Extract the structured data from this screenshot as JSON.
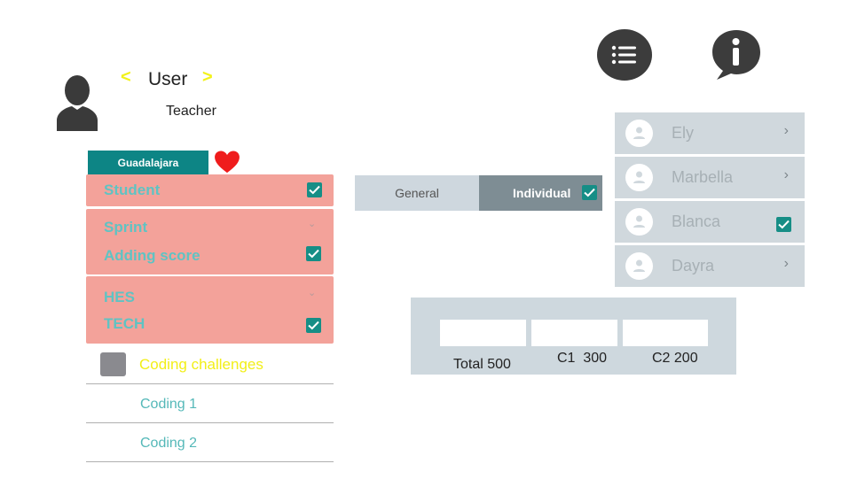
{
  "header": {
    "user_title": "User",
    "prev_arrow": "<",
    "next_arrow": ">",
    "role": "Teacher"
  },
  "location": {
    "label": "Guadalajara"
  },
  "filters": {
    "items": [
      {
        "label": "Student",
        "control": "checkbox",
        "checked": true
      },
      {
        "label": "Sprint",
        "control": "chevron"
      },
      {
        "label": "Adding score",
        "control": "checkbox",
        "checked": true
      },
      {
        "label": "HES",
        "control": "chevron"
      },
      {
        "label": "TECH",
        "control": "checkbox",
        "checked": true
      }
    ]
  },
  "coding": {
    "title": "Coding challenges",
    "items": [
      "Coding 1",
      "Coding 2"
    ]
  },
  "tabs": {
    "general": "General",
    "individual": "Individual",
    "individual_checked": true
  },
  "people": [
    {
      "name": "Ely",
      "control": "chevron"
    },
    {
      "name": "Marbella",
      "control": "chevron"
    },
    {
      "name": "Blanca",
      "control": "checkbox",
      "checked": true
    },
    {
      "name": "Dayra",
      "control": "chevron"
    }
  ],
  "scores": {
    "total": "Total 500",
    "c1": "C1  300",
    "c2": "C2 200"
  },
  "icons": {
    "menu": "list-icon",
    "info": "info-icon",
    "user": "user-icon",
    "favorite": "heart-icon"
  },
  "colors": {
    "accent": "#0d8585",
    "pink_panel": "#f3a29a",
    "label_teal": "#5fc3c3",
    "highlight_yellow": "#f2f21a",
    "heart": "#ef1c1c"
  }
}
